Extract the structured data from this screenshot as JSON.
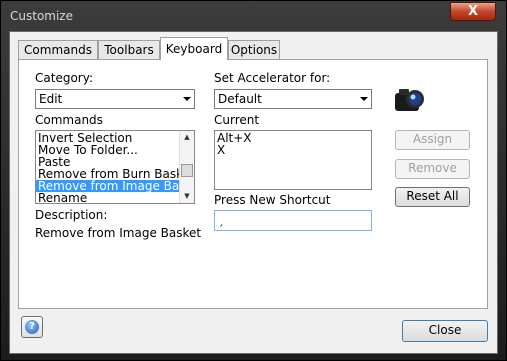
{
  "window": {
    "title": "Customize",
    "close_glyph": "X"
  },
  "tabs": [
    {
      "label": "Commands"
    },
    {
      "label": "Toolbars"
    },
    {
      "label": "Keyboard"
    },
    {
      "label": "Options"
    }
  ],
  "keyboard": {
    "category_label": "Category:",
    "category_value": "Edit",
    "commands_label": "Commands",
    "commands": [
      "Invert Selection",
      "Move To Folder...",
      "Paste",
      "Remove from Burn Bask",
      "Remove from Image Bas",
      "Rename"
    ],
    "selected_command": "Remove from Image Bas",
    "set_accel_label": "Set Accelerator for:",
    "set_accel_value": "Default",
    "current_label": "Current",
    "current_keys": [
      "Alt+X",
      "X"
    ],
    "assign_label": "Assign",
    "remove_label": "Remove",
    "reset_all_label": "Reset All",
    "press_new_shortcut_label": "Press New Shortcut",
    "shortcut_value": "ˏ",
    "description_label": "Description:",
    "description_text": "Remove from Image Basket"
  },
  "footer": {
    "close_label": "Close",
    "help_glyph": "?"
  },
  "icons": {
    "camera": "camera-icon",
    "help": "help-icon"
  },
  "colors": {
    "selection": "#3399ff",
    "accent_focus": "#7eb4ea"
  }
}
